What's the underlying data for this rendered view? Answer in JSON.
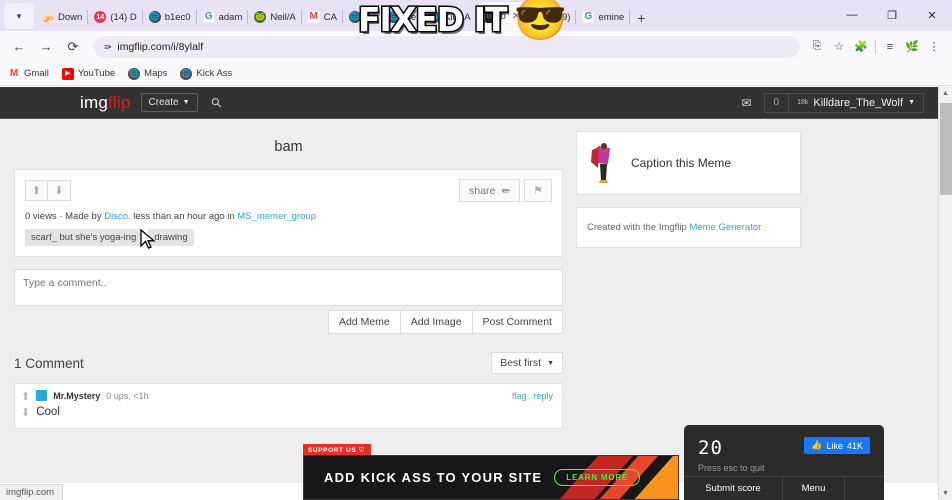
{
  "browser": {
    "tabs": [
      {
        "label": "Down",
        "icon": "banana-icon",
        "active": false
      },
      {
        "label": "(14) D",
        "icon": "notification-badge-icon",
        "active": false
      },
      {
        "label": "b1ec0",
        "icon": "globe-icon",
        "active": false
      },
      {
        "label": "adam",
        "icon": "google-icon",
        "active": false
      },
      {
        "label": "Neil/A",
        "icon": "green-globe-icon",
        "active": false
      },
      {
        "label": "CA",
        "icon": "gmail-icon",
        "active": false
      },
      {
        "label": "Wi",
        "icon": "globe-icon",
        "active": false
      },
      {
        "label": "Ne",
        "icon": "globe-icon",
        "active": false
      },
      {
        "label": "Kick A",
        "icon": "globe-icon",
        "active": false
      },
      {
        "label": "b",
        "icon": "imgflip-icon",
        "active": true
      },
      {
        "label": "(179)",
        "icon": "youtube-icon",
        "active": false
      },
      {
        "label": "emine",
        "icon": "google-icon",
        "active": false
      }
    ],
    "new_tab_label": "+",
    "window_controls": {
      "minimize": "—",
      "maximize": "❐",
      "close": "✕"
    },
    "nav": {
      "back": "←",
      "forward": "→",
      "reload": "⟳"
    },
    "omnibox": {
      "value": "imgflip.com/i/8ylalf",
      "site_settings_icon": "tune-icon"
    },
    "toolbar_icons": [
      "install-icon",
      "bookmark-star-icon",
      "extensions-puzzle-icon",
      "reading-list-icon",
      "profile-avatar-icon",
      "three-dot-menu-icon"
    ],
    "bookmarks": [
      {
        "label": "Gmail",
        "icon": "gmail-icon"
      },
      {
        "label": "YouTube",
        "icon": "youtube-icon"
      },
      {
        "label": "Maps",
        "icon": "globe-icon"
      },
      {
        "label": "Kick Ass",
        "icon": "globe-icon"
      }
    ],
    "status_text": "imgflip.com"
  },
  "site": {
    "logo_main": "img",
    "logo_accent": "flip",
    "create_label": "Create",
    "search_icon": "magnifier-icon",
    "messages_icon": "envelope-icon",
    "message_count": "0",
    "user_points": "18k",
    "username": "Killdare_The_Wolf"
  },
  "post": {
    "title": "bam",
    "upvote_icon": "arrow-up-icon",
    "downvote_icon": "arrow-down-icon",
    "share_label": "share",
    "share_icon": "share-nodes-icon",
    "flag_icon": "flag-icon",
    "views": "0 views",
    "separator": "·",
    "made_by_prefix": "Made by",
    "author": "Disco.",
    "time_text": "less than an hour ago in",
    "stream": "MS_memer_group",
    "tags": [
      "scarf_ but she's yoga-ing",
      "drawing"
    ]
  },
  "comment_form": {
    "placeholder": "Type a comment..",
    "value": "",
    "buttons": [
      "Add Meme",
      "Add Image",
      "Post Comment"
    ]
  },
  "comments": {
    "heading": "1 Comment",
    "sort_label": "Best first",
    "items": [
      {
        "user": "Mr.Mystery",
        "meta": "0 ups, <1h",
        "text": "Cool",
        "flag_label": "flag",
        "reply_label": "reply"
      }
    ]
  },
  "sidebar": {
    "caption_label": "Caption this Meme",
    "created_prefix": "Created with the Imgflip",
    "generator_link": "Meme Generator"
  },
  "ad": {
    "support_label": "SUPPORT US ♡",
    "headline": "ADD KICK ASS TO YOUR SITE",
    "cta": "LEARN MORE",
    "colors": {
      "red": "#e53027",
      "green": "#47e847",
      "orange": "#f7941e"
    }
  },
  "game": {
    "score": "20",
    "hint": "Press esc to quit",
    "like_label": "Like",
    "like_count": "41K",
    "like_icon": "thumbs-up-icon",
    "submit_label": "Submit score",
    "menu_label": "Menu",
    "like_color": "#1877f2"
  },
  "overlay": {
    "text": "FIXED IT",
    "emoji": "😎"
  },
  "scrollbar": {
    "up_icon": "▲",
    "down_icon": "▼"
  }
}
